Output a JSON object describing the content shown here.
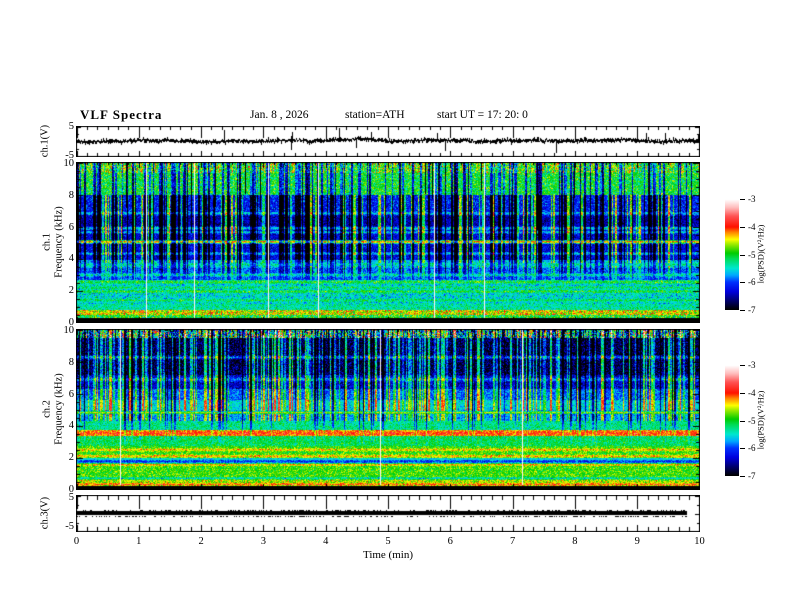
{
  "title": {
    "main": "VLF  Spectra",
    "date": "Jan. 8 , 2026",
    "station": "station=ATH",
    "start": "start UT =  17: 20: 0"
  },
  "axes": {
    "time": {
      "label": "Time  (min)",
      "ticks": [
        "0",
        "1",
        "2",
        "3",
        "4",
        "5",
        "6",
        "7",
        "8",
        "9",
        "10"
      ],
      "range": [
        0,
        10
      ],
      "minor_divisions": 6
    },
    "wave1": {
      "label": "ch.1(V)",
      "ticks": [
        "5",
        "-5"
      ],
      "range": [
        -5,
        5
      ]
    },
    "spec1": {
      "label_line1": "ch.1",
      "label_line2": "Frequency  (kHz)",
      "ticks": [
        "10",
        "8",
        "6",
        "4",
        "2",
        "0"
      ],
      "range": [
        0,
        10
      ],
      "minor_step_khz": 0.5
    },
    "spec2": {
      "label_line1": "ch.2",
      "label_line2": "Frequency  (kHz)",
      "ticks": [
        "10",
        "8",
        "6",
        "4",
        "2",
        "0"
      ],
      "range": [
        0,
        10
      ],
      "minor_step_khz": 0.5
    },
    "wave3": {
      "label": "ch.3(V)",
      "ticks": [
        "5",
        "-5"
      ],
      "range": [
        -5,
        5
      ]
    }
  },
  "colorbar": {
    "label": "log(PSD)(V²/Hz)",
    "ticks": [
      "-3",
      "-4",
      "-5",
      "-6",
      "-7"
    ],
    "range": [
      -7,
      -3
    ],
    "stops": [
      [
        -7.0,
        "#000000"
      ],
      [
        -6.7,
        "#000066"
      ],
      [
        -6.35,
        "#0000dd"
      ],
      [
        -6.0,
        "#0033ff"
      ],
      [
        -5.75,
        "#00aaff"
      ],
      [
        -5.5,
        "#00e8d0"
      ],
      [
        -5.15,
        "#00dd55"
      ],
      [
        -4.95,
        "#00cc00"
      ],
      [
        -4.6,
        "#aaee00"
      ],
      [
        -4.45,
        "#ffff00"
      ],
      [
        -4.2,
        "#ff8800"
      ],
      [
        -4.0,
        "#ff1100"
      ],
      [
        -3.6,
        "#ff5555"
      ],
      [
        -3.3,
        "#ffbbbb"
      ],
      [
        -3.0,
        "#ffffff"
      ]
    ]
  },
  "chart_data": [
    {
      "type": "line",
      "name": "ch1-waveform",
      "ylabel": "ch.1(V)",
      "xlim": [
        0,
        10
      ],
      "ylim": [
        -5,
        5
      ],
      "signal": {
        "mean": 0,
        "noise_sigma": 0.5,
        "spike_rate": 0.022,
        "spike_amp": [
          1.8,
          4.6
        ],
        "seed": 101
      }
    },
    {
      "type": "heatmap",
      "name": "ch1-spectrogram",
      "ylabel": "ch.1 Frequency (kHz)",
      "zlabel": "log(PSD)(V²/Hz)",
      "xlim": [
        0,
        10
      ],
      "ylim": [
        0,
        10
      ],
      "zlim": [
        -7,
        -3
      ],
      "seed": 202,
      "bands": [
        {
          "f": [
            9.4,
            10.01
          ],
          "v": -4.85,
          "n": 0.55
        },
        {
          "f": [
            8.0,
            9.4
          ],
          "v": -5.05,
          "n": 0.4
        },
        {
          "f": [
            7.0,
            8.0
          ],
          "v": -6.15,
          "n": 0.35
        },
        {
          "f": [
            6.0,
            7.0
          ],
          "v": -6.5,
          "n": 0.3
        },
        {
          "f": [
            5.15,
            6.0
          ],
          "v": -6.35,
          "n": 0.3
        },
        {
          "f": [
            3.9,
            5.15
          ],
          "v": -6.3,
          "n": 0.3
        },
        {
          "f": [
            3.4,
            3.9
          ],
          "v": -5.7,
          "n": 0.3
        },
        {
          "f": [
            2.6,
            3.4
          ],
          "v": -5.9,
          "n": 0.3
        },
        {
          "f": [
            1.1,
            2.6
          ],
          "v": -5.5,
          "n": 0.35
        },
        {
          "f": [
            0.7,
            1.1
          ],
          "v": -5.35,
          "n": 0.3
        },
        {
          "f": [
            0.42,
            0.7
          ],
          "v": -4.5,
          "n": 0.5
        },
        {
          "f": [
            0.2,
            0.42
          ],
          "v": -5.0,
          "n": 0.5
        },
        {
          "f": [
            0.0,
            0.2
          ],
          "v": -7.3,
          "n": 0.1
        }
      ],
      "lines": [
        {
          "f": 6.85,
          "v": -5.6,
          "w": 0.07
        },
        {
          "f": 5.9,
          "v": -5.55,
          "w": 0.06
        },
        {
          "f": 5.65,
          "v": -5.6,
          "w": 0.05
        },
        {
          "f": 5.05,
          "v": -4.15,
          "w": 0.06
        },
        {
          "f": 4.3,
          "v": -5.6,
          "w": 0.05
        },
        {
          "f": 3.6,
          "v": -5.35,
          "w": 0.06
        },
        {
          "f": 2.95,
          "v": -5.25,
          "w": 0.05
        },
        {
          "f": 2.5,
          "v": -4.95,
          "w": 0.06
        },
        {
          "f": 2.15,
          "v": -5.2,
          "w": 0.04
        },
        {
          "f": 1.9,
          "v": -5.0,
          "w": 0.05
        },
        {
          "f": 1.35,
          "v": -5.15,
          "w": 0.04
        }
      ],
      "streaks": {
        "white": 0.008,
        "black": 0.018,
        "dark": 0.26,
        "dark_amp": [
          0.7,
          1.8
        ],
        "bright": 0.13,
        "bright_amp": [
          0.8,
          1.8
        ],
        "fade_lo": 2.2,
        "fade_hi": 4.5
      },
      "top_stripe": {
        "f": 9.4,
        "amp": 0.45
      }
    },
    {
      "type": "heatmap",
      "name": "ch2-spectrogram",
      "ylabel": "ch.2 Frequency (kHz)",
      "zlabel": "log(PSD)(V²/Hz)",
      "xlim": [
        0,
        10
      ],
      "ylim": [
        0,
        10
      ],
      "zlim": [
        -7,
        -3
      ],
      "seed": 303,
      "bands": [
        {
          "f": [
            9.55,
            10.01
          ],
          "v": -5.8,
          "n": 0.9
        },
        {
          "f": [
            7.2,
            9.55
          ],
          "v": -6.8,
          "n": 0.4
        },
        {
          "f": [
            6.3,
            7.2
          ],
          "v": -6.4,
          "n": 0.35
        },
        {
          "f": [
            5.6,
            6.3
          ],
          "v": -5.9,
          "n": 0.3
        },
        {
          "f": [
            4.95,
            5.6
          ],
          "v": -5.55,
          "n": 0.3
        },
        {
          "f": [
            4.3,
            4.95
          ],
          "v": -5.75,
          "n": 0.3
        },
        {
          "f": [
            3.7,
            4.3
          ],
          "v": -5.3,
          "n": 0.3
        },
        {
          "f": [
            3.32,
            3.7
          ],
          "v": -4.3,
          "n": 0.3
        },
        {
          "f": [
            2.7,
            3.32
          ],
          "v": -5.15,
          "n": 0.3
        },
        {
          "f": [
            1.9,
            2.7
          ],
          "v": -4.9,
          "n": 0.3
        },
        {
          "f": [
            1.55,
            1.9
          ],
          "v": -5.55,
          "n": 0.25
        },
        {
          "f": [
            0.75,
            1.55
          ],
          "v": -4.85,
          "n": 0.3
        },
        {
          "f": [
            0.3,
            0.75
          ],
          "v": -4.6,
          "n": 0.35
        },
        {
          "f": [
            0.14,
            0.3
          ],
          "v": -5.0,
          "n": 0.4
        },
        {
          "f": [
            0.0,
            0.14
          ],
          "v": -7.3,
          "n": 0.1
        }
      ],
      "lines": [
        {
          "f": 8.3,
          "v": -5.9,
          "w": 0.06
        },
        {
          "f": 6.9,
          "v": -5.8,
          "w": 0.06
        },
        {
          "f": 4.8,
          "v": -4.6,
          "w": 0.04
        },
        {
          "f": 3.5,
          "v": -3.95,
          "w": 0.08
        },
        {
          "f": 2.45,
          "v": -4.35,
          "w": 0.05
        },
        {
          "f": 2.05,
          "v": -4.3,
          "w": 0.05
        },
        {
          "f": 1.72,
          "v": -6.1,
          "w": 0.05
        },
        {
          "f": 1.5,
          "v": -4.35,
          "w": 0.04
        },
        {
          "f": 0.65,
          "v": -5.5,
          "w": 0.04
        },
        {
          "f": 0.25,
          "v": -4.05,
          "w": 0.04
        }
      ],
      "streaks": {
        "white": 0.006,
        "black": 0.012,
        "dark": 0.1,
        "dark_amp": [
          0.6,
          1.4
        ],
        "bright": 0.3,
        "bright_amp": [
          0.7,
          1.7
        ],
        "fade_lo": 2.5,
        "fade_hi": 4.8
      },
      "top_stripe": {
        "f": 9.55,
        "amp": 1.1
      }
    },
    {
      "type": "line",
      "name": "ch3-waveform",
      "ylabel": "ch.3(V)",
      "xlim": [
        0,
        10
      ],
      "ylim": [
        -5,
        5
      ],
      "signal": {
        "constant": 0,
        "x_end": 9.82,
        "thickness_v": 1.2,
        "seed": 404
      }
    }
  ]
}
